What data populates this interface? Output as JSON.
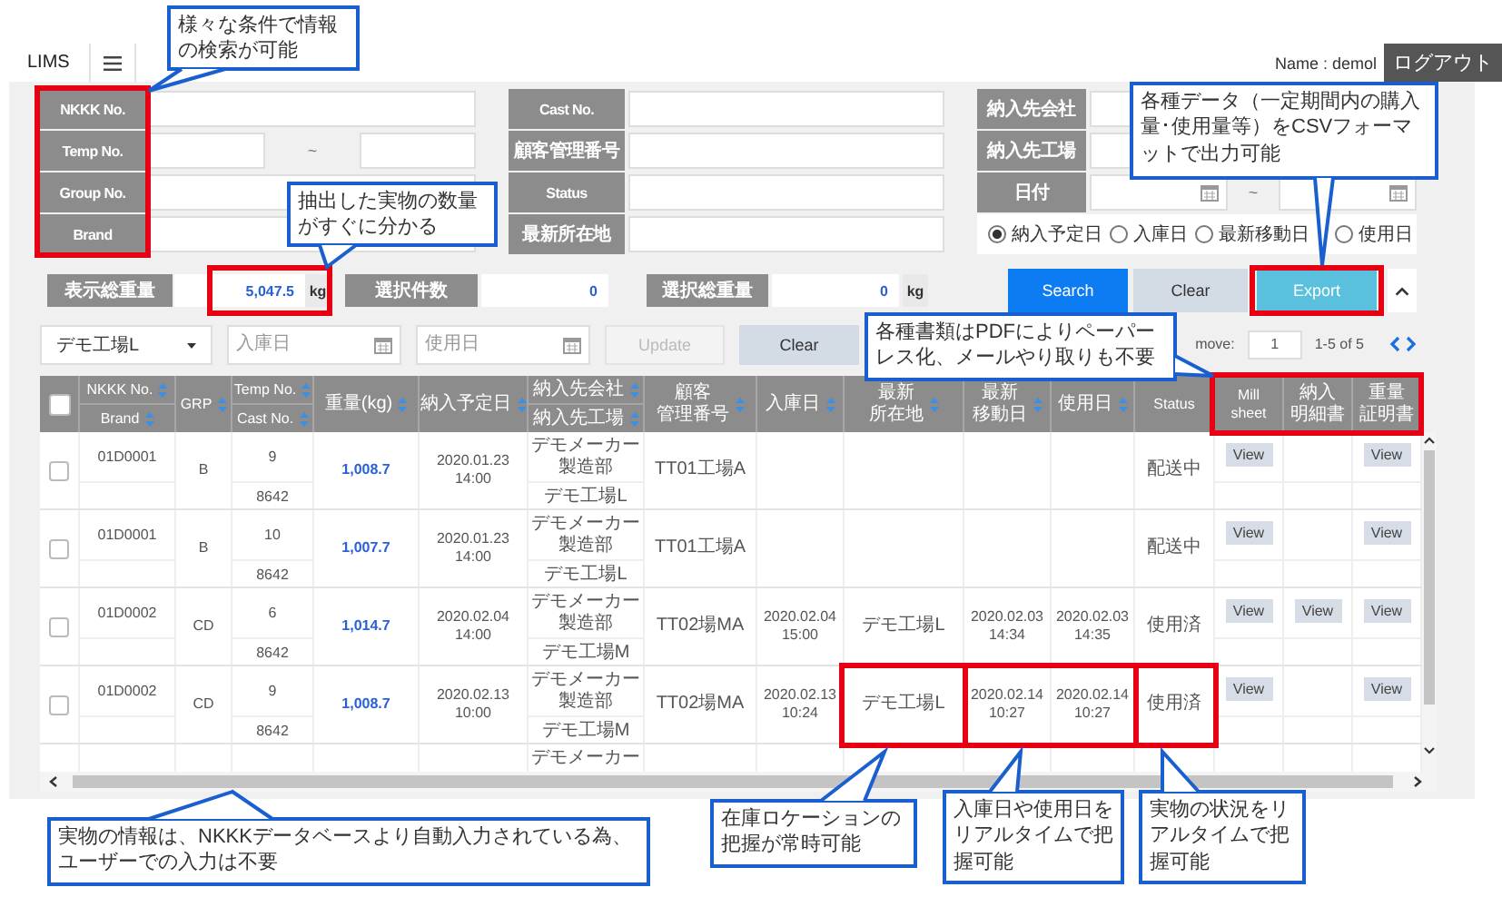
{
  "header": {
    "app_title": "LIMS",
    "user_label": "Name : demol",
    "logout_button": "ログアウト"
  },
  "search_form": {
    "columns": [
      [
        {
          "label": "NKKK No.",
          "kind": "text"
        },
        {
          "label": "Temp No.",
          "kind": "range",
          "separator": "~"
        },
        {
          "label": "Group No.",
          "kind": "text"
        },
        {
          "label": "Brand",
          "kind": "text"
        }
      ],
      [
        {
          "label": "Cast No.",
          "kind": "text"
        },
        {
          "label": "顧客管理番号",
          "kind": "text"
        },
        {
          "label": "Status",
          "kind": "text"
        },
        {
          "label": "最新所在地",
          "kind": "text"
        }
      ],
      [
        {
          "label": "納入先会社",
          "kind": "text"
        },
        {
          "label": "納入先工場",
          "kind": "text"
        },
        {
          "label": "日付",
          "kind": "date_range",
          "separator": "~"
        }
      ]
    ],
    "date_options": [
      {
        "label": "納入予定日",
        "selected": true
      },
      {
        "label": "入庫日",
        "selected": false
      },
      {
        "label": "最新移動日",
        "selected": false
      },
      {
        "label": "使用日",
        "selected": false
      }
    ]
  },
  "totals": [
    {
      "label": "表示総重量",
      "value": "5,047.5",
      "unit": "kg"
    },
    {
      "label": "選択件数",
      "value": "0"
    },
    {
      "label": "選択総重量",
      "value": "0",
      "unit": "kg"
    }
  ],
  "actions": [
    {
      "label": "Search",
      "kind": "primary"
    },
    {
      "label": "Clear",
      "kind": "secondary"
    },
    {
      "label": "Export",
      "kind": "export"
    }
  ],
  "filter_bar": {
    "location": "デモ工場L",
    "date_fields": [
      {
        "placeholder": "入庫日"
      },
      {
        "placeholder": "使用日"
      }
    ],
    "buttons": [
      {
        "label": "Update",
        "disabled": true
      },
      {
        "label": "Clear",
        "disabled": false
      }
    ],
    "move_label": "move:",
    "move_value": "1",
    "page_info": "1-5 of 5"
  },
  "table": {
    "select_all": {
      "checked": false
    },
    "columns": [
      {
        "kind": "split",
        "parts": [
          {
            "label": "NKKK No.",
            "sortable": true
          },
          {
            "label": "Brand",
            "sortable": true
          }
        ]
      },
      {
        "kind": "single",
        "lines": [
          "GRP"
        ],
        "sortable": true
      },
      {
        "kind": "split",
        "parts": [
          {
            "label": "Temp No.",
            "sortable": true
          },
          {
            "label": "Cast No.",
            "sortable": true
          }
        ]
      },
      {
        "kind": "single",
        "lines": [
          "重量(kg)"
        ],
        "sortable": true
      },
      {
        "kind": "single",
        "lines": [
          "納入予定日"
        ],
        "sortable": true
      },
      {
        "kind": "split",
        "parts": [
          {
            "label": "納入先会社",
            "sortable": true
          },
          {
            "label": "納入先工場",
            "sortable": true
          }
        ]
      },
      {
        "kind": "single",
        "lines": [
          "顧客",
          "管理番号"
        ],
        "sortable": true
      },
      {
        "kind": "single",
        "lines": [
          "入庫日"
        ],
        "sortable": true
      },
      {
        "kind": "single",
        "lines": [
          "最新",
          "所在地"
        ],
        "sortable": true
      },
      {
        "kind": "single",
        "lines": [
          "最新",
          "移動日"
        ],
        "sortable": true
      },
      {
        "kind": "single",
        "lines": [
          "使用日"
        ],
        "sortable": true
      },
      {
        "kind": "single",
        "lines": [
          "Status"
        ],
        "sortable": false
      },
      {
        "kind": "single",
        "lines": [
          "Mill",
          "sheet"
        ],
        "sortable": false
      },
      {
        "kind": "single",
        "lines": [
          "納入",
          "明細書"
        ],
        "sortable": false
      },
      {
        "kind": "single",
        "lines": [
          "重量",
          "証明書"
        ],
        "sortable": false
      }
    ],
    "rows": [
      {
        "checked": false,
        "nkkk_no": "01D0001",
        "grp": "B",
        "temp_no": "9",
        "cast_no": "8642",
        "weight": "1,008.7",
        "delivery_date": [
          "2020.01.23",
          "14:00"
        ],
        "supplier_company": [
          "デモメーカー",
          "製造部"
        ],
        "supplier_factory": "デモ工場L",
        "customer_no": "TT01工場A",
        "status": "配送中",
        "mill_sheet": "View",
        "weight_certificate": "View"
      },
      {
        "checked": false,
        "nkkk_no": "01D0001",
        "grp": "B",
        "temp_no": "10",
        "cast_no": "8642",
        "weight": "1,007.7",
        "delivery_date": [
          "2020.01.23",
          "14:00"
        ],
        "supplier_company": [
          "デモメーカー",
          "製造部"
        ],
        "supplier_factory": "デモ工場L",
        "customer_no": "TT01工場A",
        "status": "配送中",
        "mill_sheet": "View",
        "weight_certificate": "View"
      },
      {
        "checked": false,
        "nkkk_no": "01D0002",
        "grp": "CD",
        "temp_no": "6",
        "cast_no": "8642",
        "weight": "1,014.7",
        "delivery_date": [
          "2020.02.04",
          "14:00"
        ],
        "supplier_company": [
          "デモメーカー",
          "製造部"
        ],
        "supplier_factory": "デモ工場M",
        "customer_no": "TT02場MA",
        "arrival_date": [
          "2020.02.04",
          "15:00"
        ],
        "location": "デモ工場L",
        "moved_at": [
          "2020.02.03",
          "14:34"
        ],
        "used_at": [
          "2020.02.03",
          "14:35"
        ],
        "status": "使用済",
        "mill_sheet": "View",
        "delivery_statement": "View",
        "weight_certificate": "View"
      },
      {
        "checked": false,
        "nkkk_no": "01D0002",
        "grp": "CD",
        "temp_no": "9",
        "cast_no": "8642",
        "weight": "1,008.7",
        "delivery_date": [
          "2020.02.13",
          "10:00"
        ],
        "supplier_company": [
          "デモメーカー",
          "製造部"
        ],
        "supplier_factory": "デモ工場M",
        "customer_no": "TT02場MA",
        "arrival_date": [
          "2020.02.13",
          "10:24"
        ],
        "location": "デモ工場L",
        "moved_at": [
          "2020.02.14",
          "10:27"
        ],
        "used_at": [
          "2020.02.14",
          "10:27"
        ],
        "status": "使用済",
        "mill_sheet": "View",
        "weight_certificate": "View"
      },
      {
        "supplier_company": [
          "デモメーカー"
        ]
      }
    ]
  },
  "annotations": {
    "callouts": [
      {
        "text": "様々な条件で情報の検索が可能"
      },
      {
        "text": "抽出した実物の数量がすぐに分かる"
      },
      {
        "text": "各種データ（一定期間内の購入量･使用量等）をCSVフォーマットで出力可能"
      },
      {
        "text": "各種書類はPDFによりペーパーレス化、メールやり取りも不要"
      },
      {
        "text": "実物の情報は、NKKKデータベースより自動入力されている為、ユーザーでの入力は不要"
      },
      {
        "text": "在庫ロケーションの把握が常時可能"
      },
      {
        "text": "入庫日や使用日をリアルタイムで把握可能"
      },
      {
        "text": "実物の状況をリアルタイムで把握可能"
      }
    ],
    "highlights": [
      {
        "kind": "labels"
      },
      {
        "kind": "total"
      },
      {
        "kind": "export"
      },
      {
        "kind": "documents"
      },
      {
        "kind": "location"
      },
      {
        "kind": "dates"
      },
      {
        "kind": "status"
      }
    ]
  }
}
